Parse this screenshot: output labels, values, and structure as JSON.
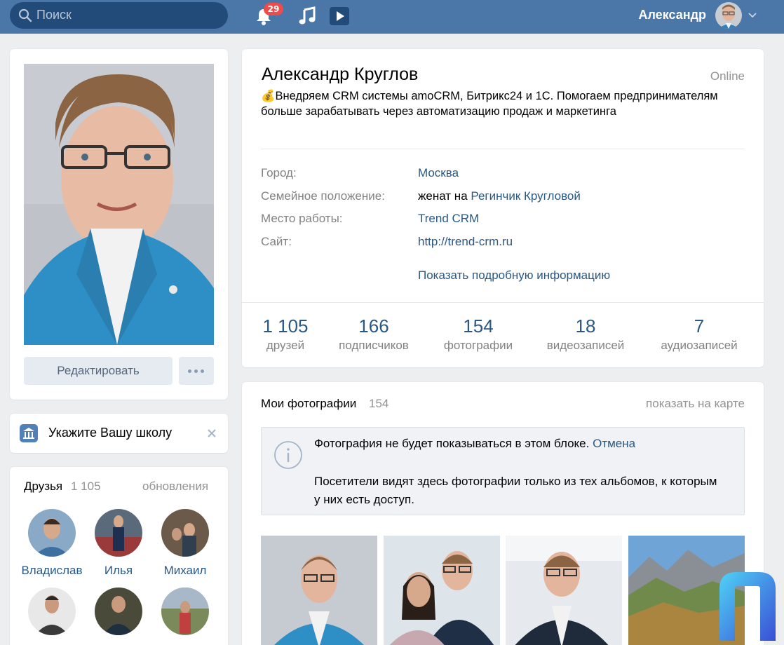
{
  "header": {
    "search_placeholder": "Поиск",
    "notifications_count": "29",
    "user_name": "Александр",
    "colors": {
      "bar": "#4a76a8",
      "search": "#224b7a",
      "badge": "#ee4b4b"
    }
  },
  "left": {
    "edit_button": "Редактировать",
    "school_prompt": "Укажите Вашу школу",
    "friends": {
      "title": "Друзья",
      "count": "1 105",
      "updates": "обновления",
      "items": [
        {
          "name": "Владислав"
        },
        {
          "name": "Илья"
        },
        {
          "name": "Михаил"
        },
        {
          "name": ""
        },
        {
          "name": ""
        },
        {
          "name": ""
        }
      ]
    }
  },
  "profile": {
    "name": "Александр Круглов",
    "online": "Online",
    "status": "💰Внедряем CRM системы amoCRM, Битрикс24 и 1С. Помогаем предпринимателям больше зарабатывать через автоматизацию продаж и маркетинга",
    "info": {
      "city_label": "Город:",
      "city": "Москва",
      "family_label": "Семейное положение:",
      "family_prefix": "женат на ",
      "family_link": "Регинчик Кругловой",
      "work_label": "Место работы:",
      "work": "Trend CRM",
      "site_label": "Сайт:",
      "site": "http://trend-crm.ru",
      "more": "Показать подробную информацию"
    },
    "stats": [
      {
        "n": "1 105",
        "l": "друзей"
      },
      {
        "n": "166",
        "l": "подписчиков"
      },
      {
        "n": "154",
        "l": "фотографии"
      },
      {
        "n": "18",
        "l": "видеозаписей"
      },
      {
        "n": "7",
        "l": "аудиозаписей"
      }
    ]
  },
  "photos": {
    "title": "Мои фотографии",
    "count": "154",
    "map_link": "показать на карте",
    "notice_text": "Фотография не будет показываться в этом блоке. ",
    "notice_link": "Отмена",
    "notice_text2": "Посетители видят здесь фотографии только из тех альбомов, к которым у них есть доступ."
  }
}
